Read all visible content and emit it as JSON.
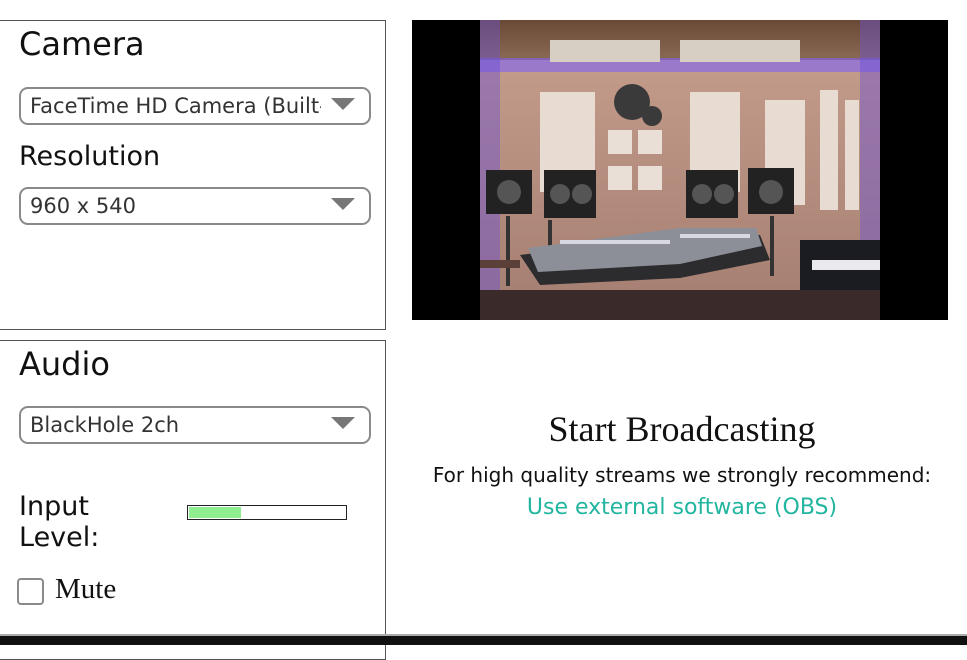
{
  "camera": {
    "heading": "Camera",
    "device_value": "FaceTime HD Camera (Built-in)",
    "resolution_label": "Resolution",
    "resolution_value": "960 x 540"
  },
  "audio": {
    "heading": "Audio",
    "device_value": "BlackHole 2ch",
    "input_level_label": "Input Level:",
    "input_level": 0.33,
    "mute_label": "Mute",
    "mute_checked": false
  },
  "broadcast": {
    "title": "Start Broadcasting",
    "recommendation": "For high quality streams we strongly recommend:",
    "obs_link": "Use external software (OBS)"
  },
  "colors": {
    "link": "#22b5a0",
    "meter_fill": "#90ee90"
  }
}
